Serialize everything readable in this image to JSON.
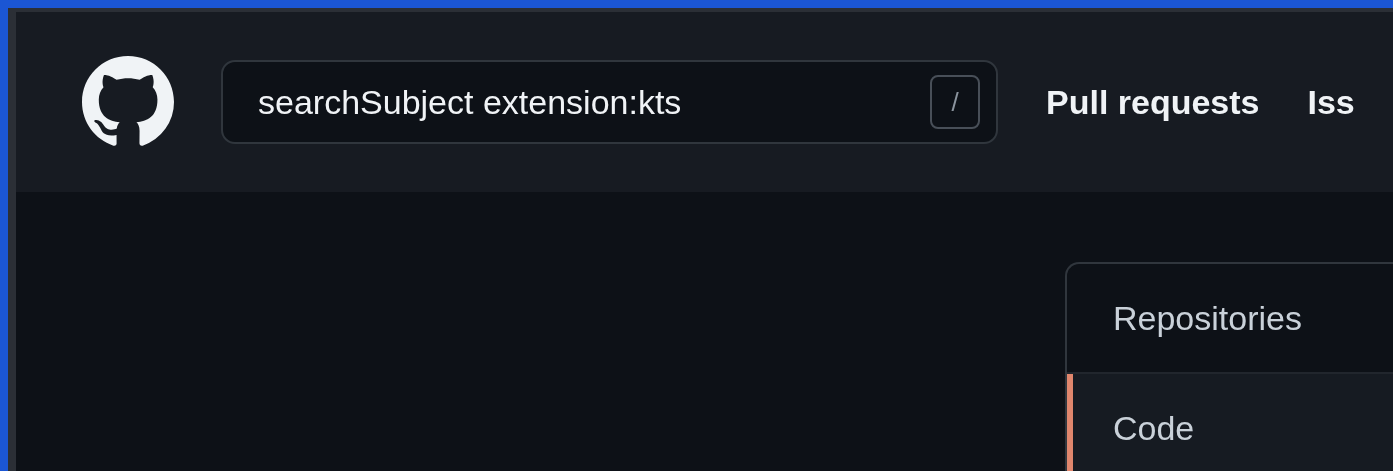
{
  "header": {
    "search": {
      "value": "searchSubject extension:kts",
      "shortcut": "/"
    },
    "nav": [
      {
        "label": "Pull requests"
      },
      {
        "label": "Iss"
      }
    ]
  },
  "filter_menu": {
    "items": [
      {
        "label": "Repositories",
        "selected": false
      },
      {
        "label": "Code",
        "selected": true
      }
    ]
  }
}
